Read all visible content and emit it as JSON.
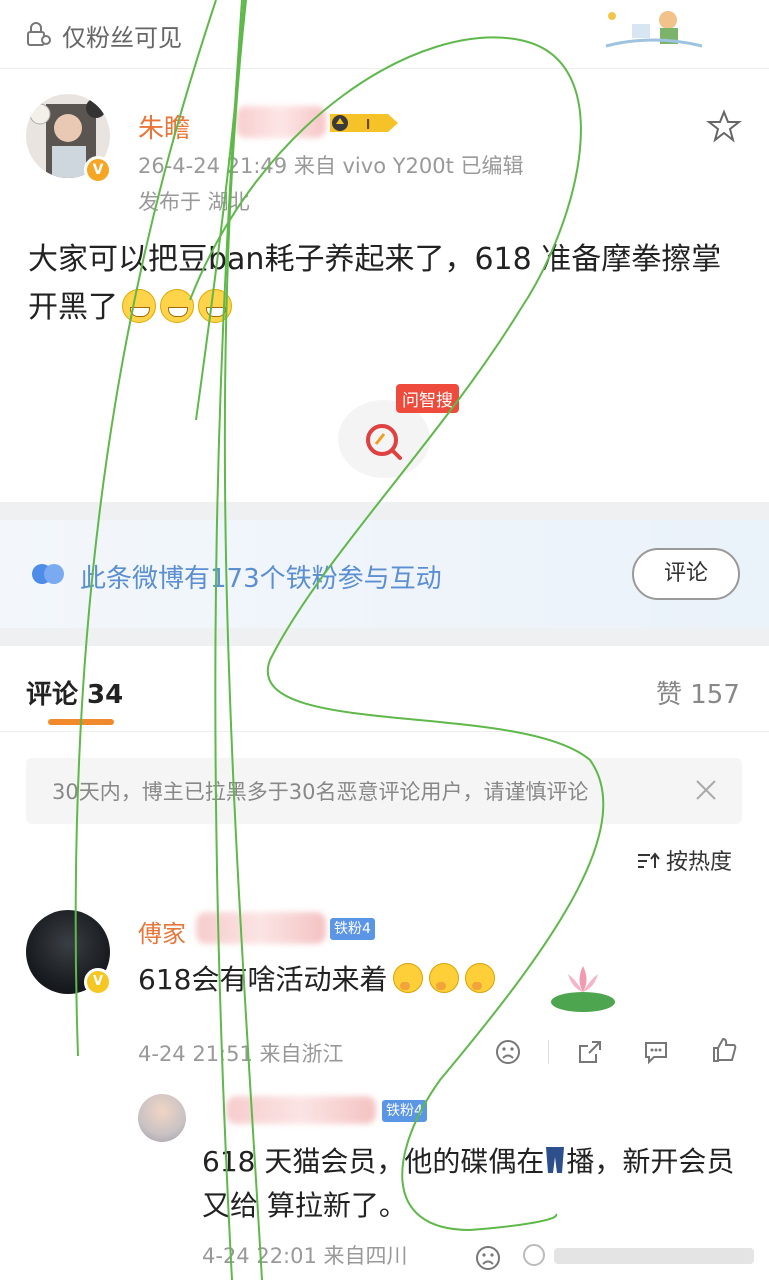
{
  "topbar": {
    "visibility_text": "仅粉丝可见"
  },
  "post": {
    "author_name": "朱瞻",
    "author_level": "I",
    "avatar_badge": "V",
    "meta": "26-4-24 21:49  来自 vivo Y200t  已编辑",
    "location": "发布于 湖北",
    "text": "大家可以把豆ban耗子养起来了，618 准备摩拳擦掌开黑了",
    "smart_search_label": "问智搜"
  },
  "fans": {
    "text": "此条微博有173个铁粉参与互动",
    "comment_button": "评论"
  },
  "tabs": {
    "comments": "评论 34",
    "likes": "赞 157"
  },
  "notice": {
    "text": "30天内，博主已拉黑多于30名恶意评论用户，请谨慎评论"
  },
  "sort": {
    "label": "按热度"
  },
  "comments": [
    {
      "name": "傅家",
      "fan_badge": "铁粉4",
      "avatar_badge": "V",
      "text": "618会有啥活动来着",
      "meta": "4-24 21:51 来自浙江"
    }
  ],
  "reply": {
    "fan_badge": "铁粉4",
    "text_1": "618 天猫会员，他的碟偶在",
    "text_2": "播，新开会员又给",
    "text_3": "算拉新了。",
    "meta": "4-24 22:01 来自四川"
  },
  "colors": {
    "accent": "#e8763a",
    "link": "#5b8fd1",
    "tab_underline": "#f08a2c"
  }
}
